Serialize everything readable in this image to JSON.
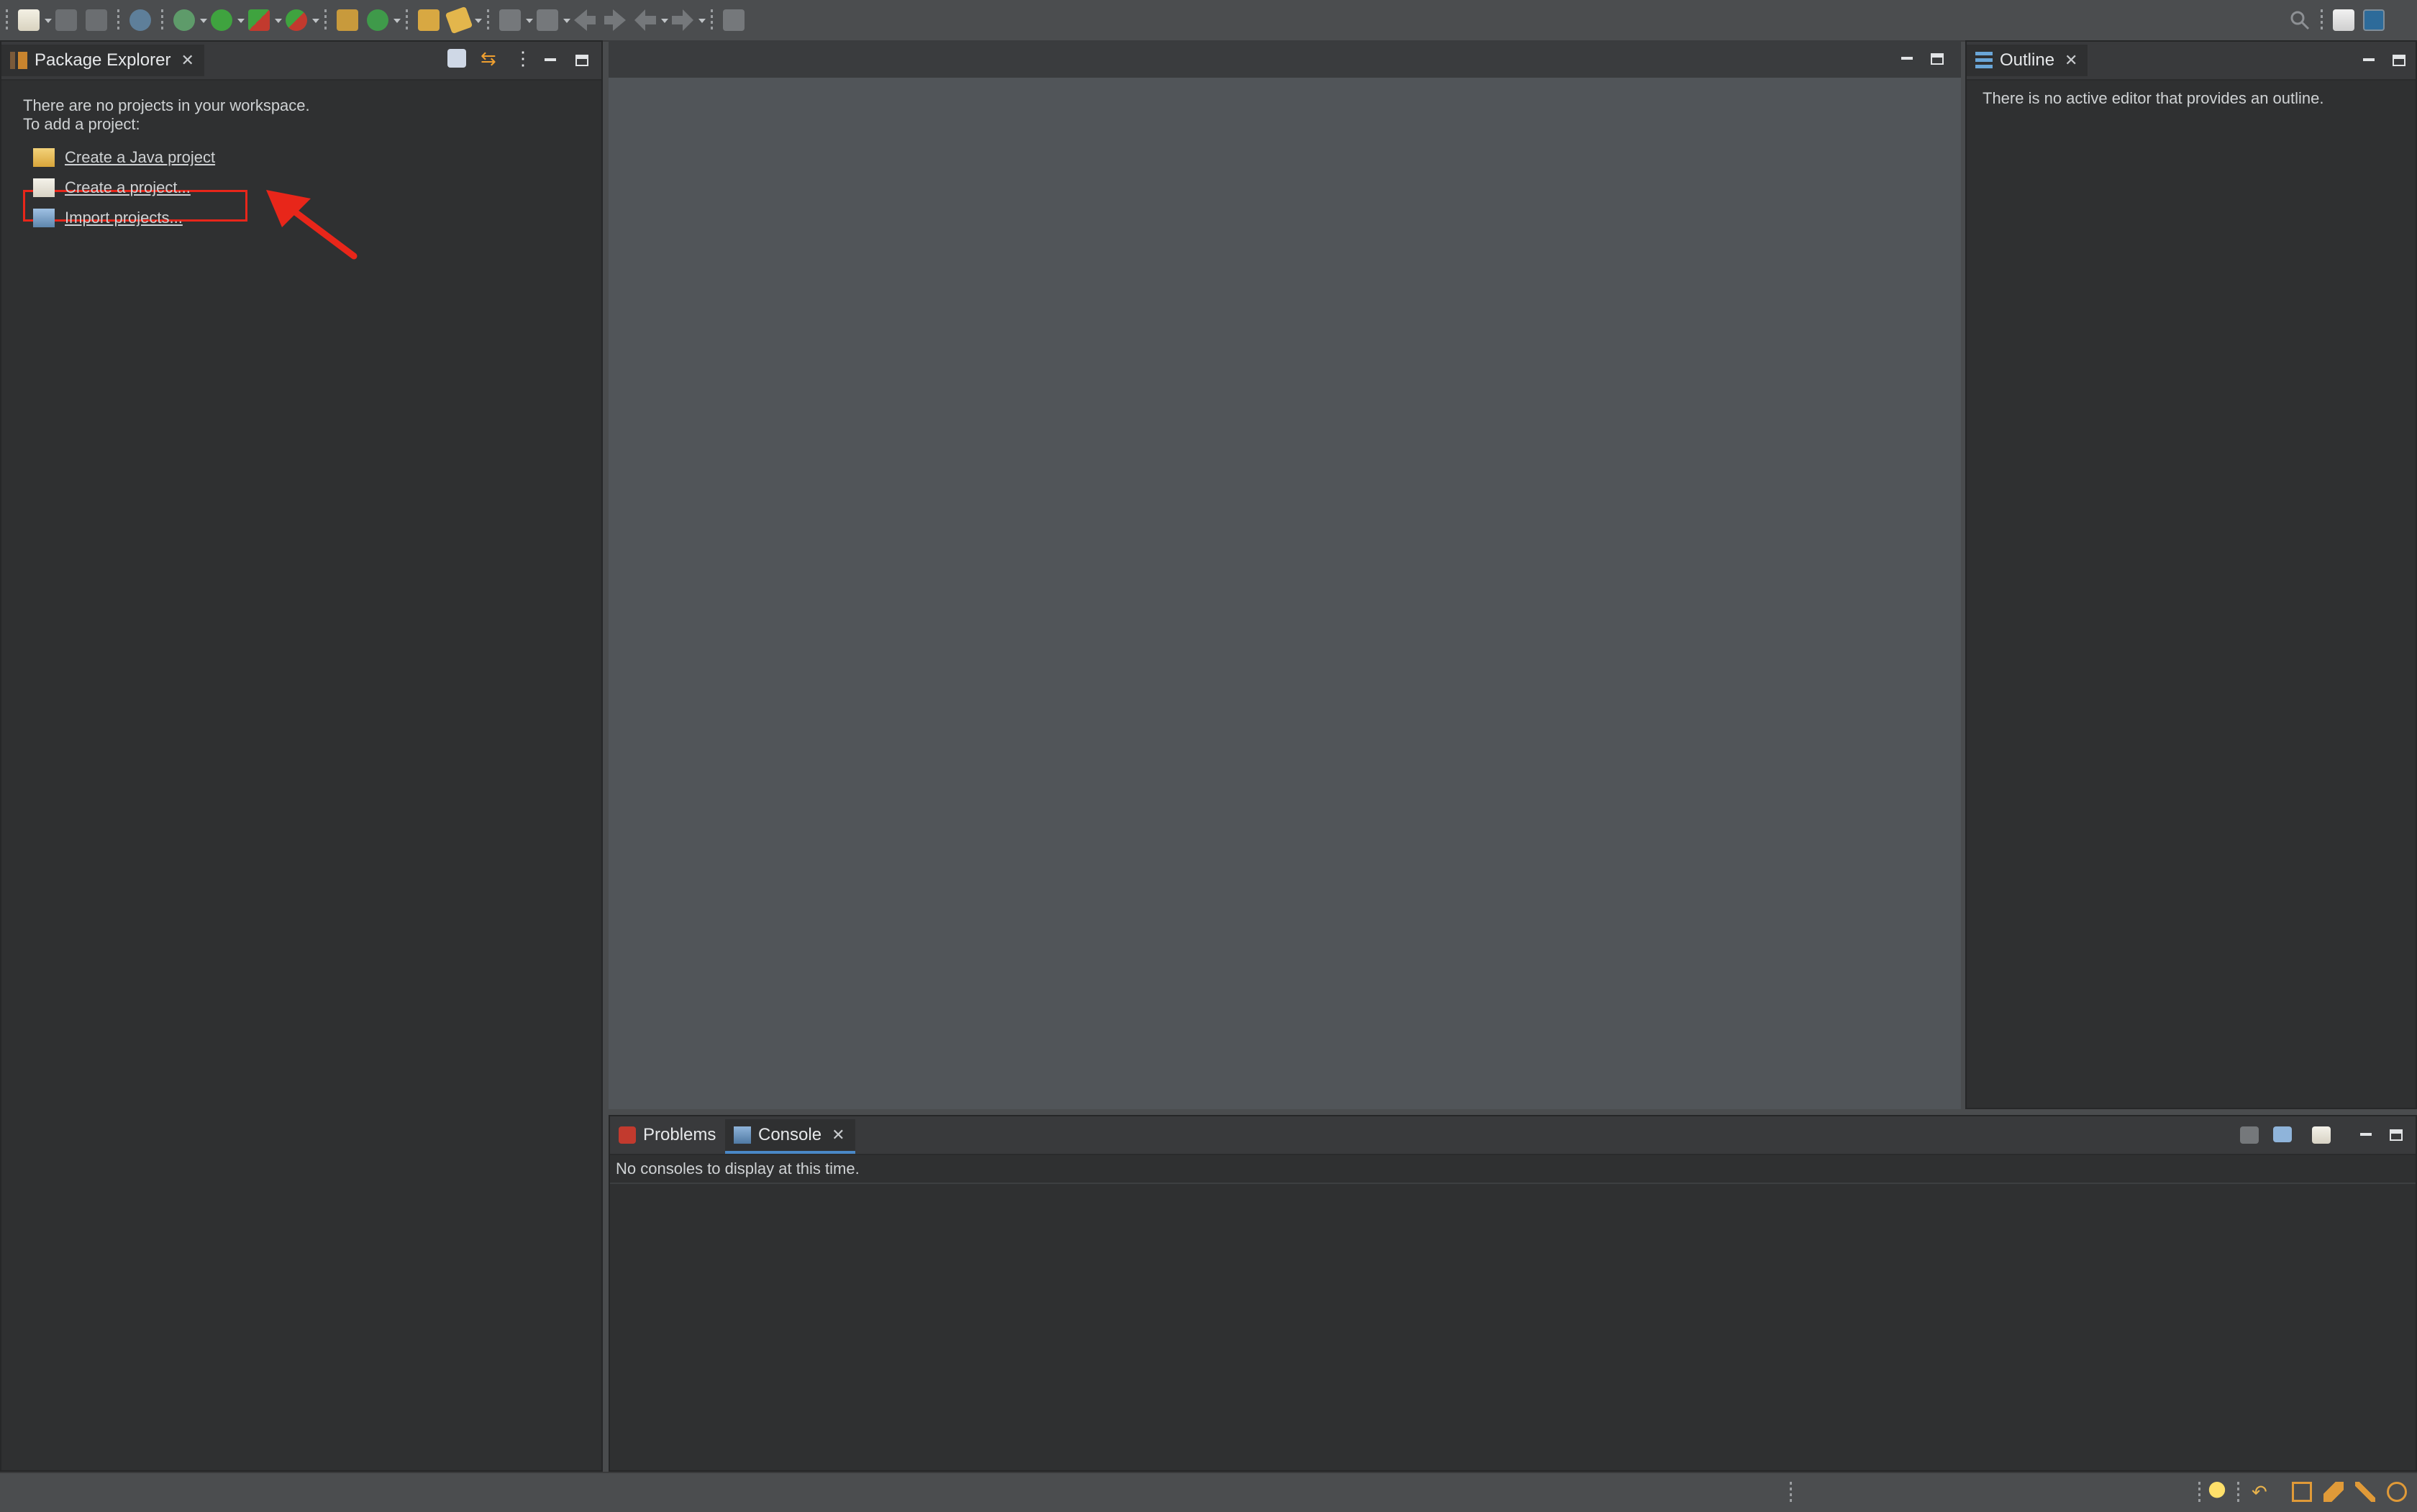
{
  "toolbar": {
    "left_icons": [
      "new-icon",
      "save-icon",
      "save-all-icon",
      "build-icon",
      "debug-icon",
      "run-icon",
      "coverage-icon",
      "external-tools-icon",
      "new-java-package-icon",
      "new-java-class-icon",
      "open-type-icon",
      "search-icon",
      "annotation-icon",
      "navigation-next-icon",
      "navigation-prev-icon",
      "back-icon",
      "forward-icon",
      "pin-editor-icon"
    ],
    "right_icons": [
      "search-icon",
      "open-perspective-icon",
      "java-perspective-icon"
    ]
  },
  "package_explorer": {
    "tab_label": "Package Explorer",
    "empty_message_line1": "There are no projects in your workspace.",
    "empty_message_line2": "To add a project:",
    "links": [
      {
        "label": "Create a Java project",
        "icon": "new-java-project-icon"
      },
      {
        "label": "Create a project...",
        "icon": "new-project-icon"
      },
      {
        "label": "Import projects...",
        "icon": "import-icon"
      }
    ]
  },
  "outline": {
    "tab_label": "Outline",
    "message": "There is no active editor that provides an outline."
  },
  "bottom": {
    "tabs": [
      {
        "label": "Problems",
        "icon": "problems-icon"
      },
      {
        "label": "Console",
        "icon": "console-icon"
      }
    ],
    "console_message": "No consoles to display at this time."
  },
  "annotation": {
    "highlight_color": "#e8261a"
  },
  "statusbar": {
    "icons": [
      "tip-icon",
      "undo-icon",
      "map-icon",
      "learn-icon",
      "wand-icon",
      "smile-icon"
    ]
  }
}
